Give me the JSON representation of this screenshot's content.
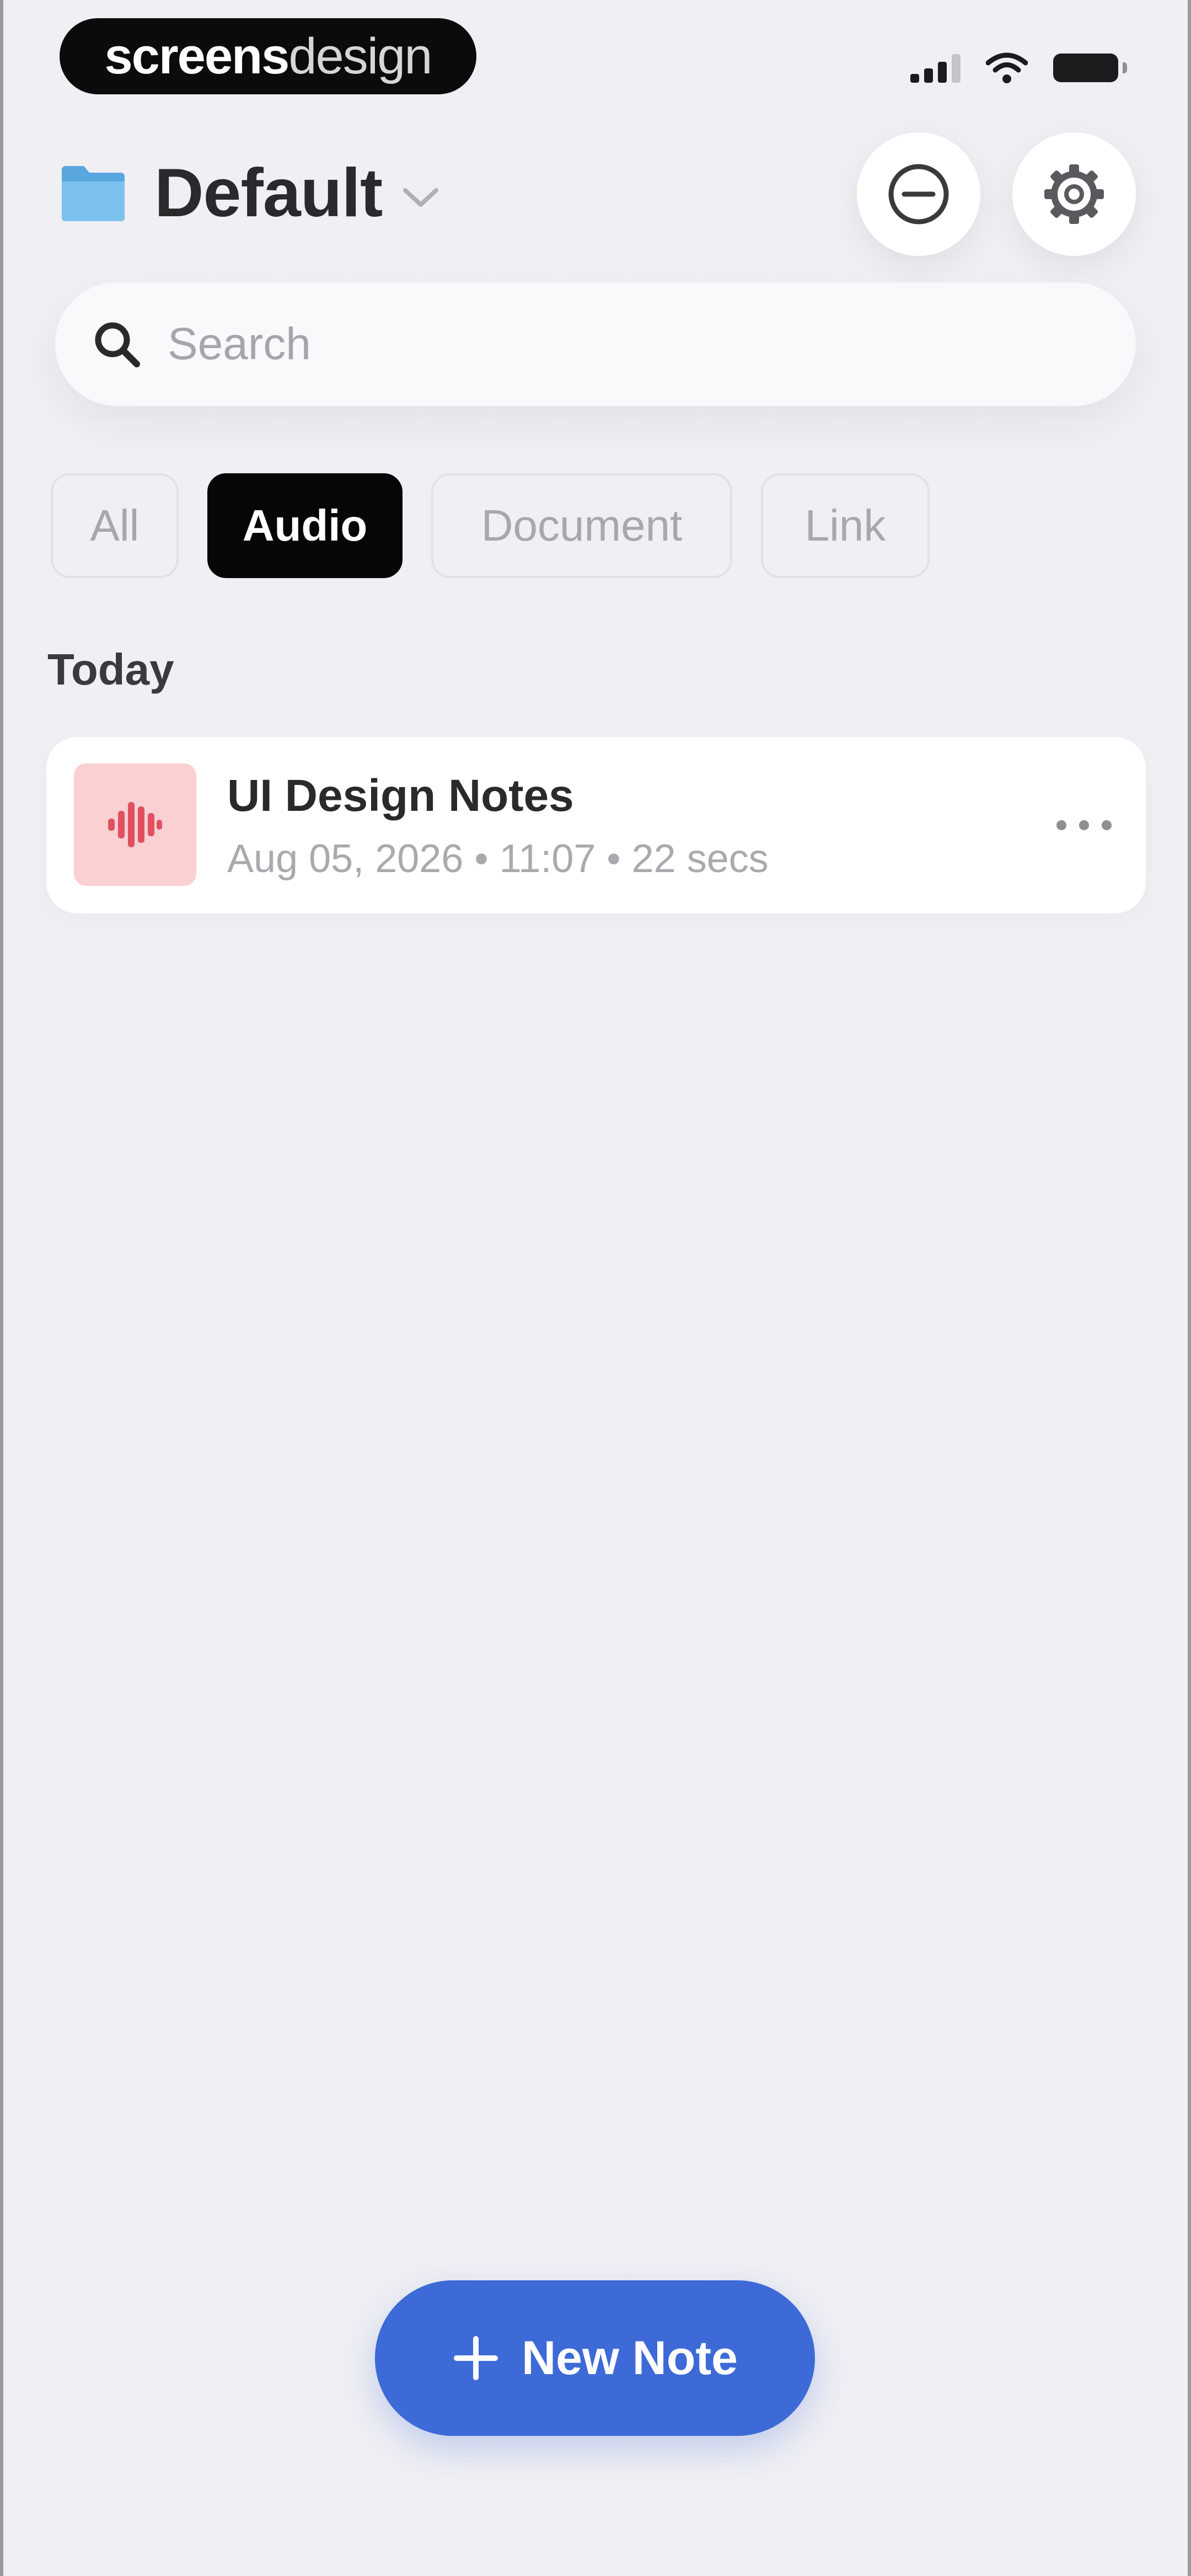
{
  "status_bar": {
    "brand_part1": "screens",
    "brand_part2": "design",
    "icons": [
      "cellular-signal-icon",
      "wifi-icon",
      "battery-icon"
    ]
  },
  "header": {
    "folder_icon": "folder-icon",
    "folder_title": "Default",
    "dropdown_icon": "chevron-down-icon",
    "actions": [
      "minus-circle-icon",
      "gear-icon"
    ]
  },
  "search": {
    "placeholder": "Search",
    "value": "",
    "icon": "search-icon"
  },
  "filters": [
    {
      "label": "All",
      "active": false
    },
    {
      "label": "Audio",
      "active": true
    },
    {
      "label": "Document",
      "active": false
    },
    {
      "label": "Link",
      "active": false
    }
  ],
  "sections": [
    {
      "label": "Today",
      "notes": [
        {
          "title": "UI Design Notes",
          "meta": "Aug 05, 2026 • 11:07 • 22 secs",
          "icon": "audio-waveform-icon",
          "more_icon": "more-horizontal-icon"
        }
      ]
    }
  ],
  "fab": {
    "label": "New Note",
    "icon": "plus-icon"
  },
  "colors": {
    "background": "#efeff4",
    "accent": "#3d6ad6",
    "chip_active": "#060606",
    "audio_thumb": "#fad0d3",
    "audio_wave": "#e1505f",
    "folder": "#6cb6e8"
  }
}
